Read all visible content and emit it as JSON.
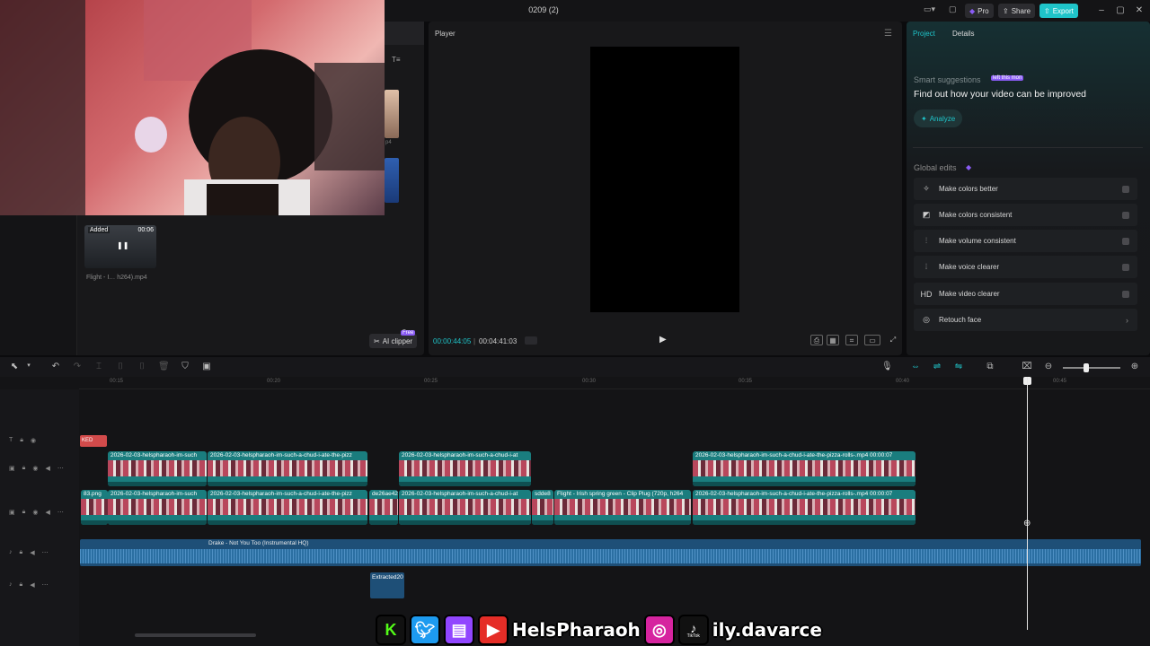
{
  "window": {
    "title": "0209 (2)",
    "pro_label": "Pro",
    "share_label": "Share",
    "export_label": "Export"
  },
  "media": {
    "sort_icon": "T≡",
    "thumb": {
      "added_label": "Added",
      "duration": "00:06",
      "name": "Flight - I… h264).mp4"
    },
    "ai_clipper_label": "AI clipper",
    "ai_clipper_badge": "Free",
    "side_label": "p4"
  },
  "player": {
    "title": "Player",
    "current_time": "00:00:44:05",
    "separator": "|",
    "total_time": "00:04:41:03"
  },
  "right_panel": {
    "tabs": [
      "Project",
      "Details"
    ],
    "smart_label": "Smart suggestions",
    "smart_badge": "left this mon",
    "smart_text": "Find out how your video can be improved",
    "analyze_label": "Analyze",
    "global_label": "Global edits",
    "global_edits": [
      {
        "icon": "wand-icon",
        "glyph": "✧",
        "label": "Make colors better",
        "kind": "toggle"
      },
      {
        "icon": "palette-icon",
        "glyph": "◩",
        "label": "Make colors consistent",
        "kind": "toggle"
      },
      {
        "icon": "sliders-icon",
        "glyph": "⫶",
        "label": "Make volume consistent",
        "kind": "toggle"
      },
      {
        "icon": "voice-icon",
        "glyph": "⦙",
        "label": "Make voice clearer",
        "kind": "toggle"
      },
      {
        "icon": "hd-icon",
        "glyph": "HD",
        "label": "Make video clearer",
        "kind": "toggle"
      },
      {
        "icon": "face-icon",
        "glyph": "◎",
        "label": "Retouch face",
        "kind": "chevron"
      }
    ]
  },
  "timeline": {
    "ruler_ticks": [
      "00:15",
      "00:20",
      "00:25",
      "00:30",
      "00:35",
      "00:40",
      "00:45"
    ],
    "text_clip_label": "KED",
    "clips_track1": [
      {
        "label": "2026-02-03-helspharaoh-im-such"
      },
      {
        "label": "2026-02-03-helspharaoh-im-such-a-chud-i-ate-the-pizz"
      },
      {
        "label": "2026-02-03-helspharaoh-im-such-a-chud-i-at"
      },
      {
        "label": "2026-02-03-helspharaoh-im-such-a-chud-i-ate-the-pizza-rolls-.mp4   00:00:07"
      }
    ],
    "clips_track2": [
      {
        "label": "83.png"
      },
      {
        "label": "2026-02-03-helspharaoh-im-such"
      },
      {
        "label": "2026-02-03-helspharaoh-im-such-a-chud-i-ate-the-pizz"
      },
      {
        "label": "de26ae42"
      },
      {
        "label": "2026-02-03-helspharaoh-im-such-a-chud-i-at"
      },
      {
        "label": "sdde8"
      },
      {
        "label": "Flight - Irish spring green - Clip Plug (720p, h264"
      },
      {
        "label": "2026-02-03-helspharaoh-im-such-a-chud-i-ate-the-pizza-rolls-.mp4   00:00:07"
      }
    ],
    "audio_label": "Drake - Not You Too (Instrumental HQ)",
    "extracted_label": "Extracted20"
  },
  "overlay": {
    "handle": "HelsPharaoh",
    "handle2": "ily.davarce",
    "tiktok_label": "TikTok"
  }
}
